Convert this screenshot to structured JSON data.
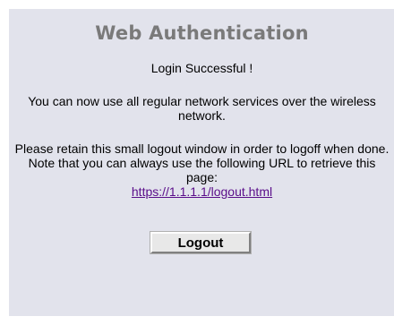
{
  "auth": {
    "title": "Web Authentication",
    "success_message": "Login Successful !",
    "services_message": "You can now use all regular network services over the wireless network.",
    "retain_message": "Please retain this small logout window in order to logoff when done. Note that you can always use the following URL to retrieve this page:",
    "logout_url_text": "https://1.1.1.1/logout.html",
    "logout_button_label": "Logout"
  },
  "colors": {
    "panel_background": "#e2e3ec",
    "title_color": "#7a7a7a",
    "link_color": "#5a0e8a"
  }
}
